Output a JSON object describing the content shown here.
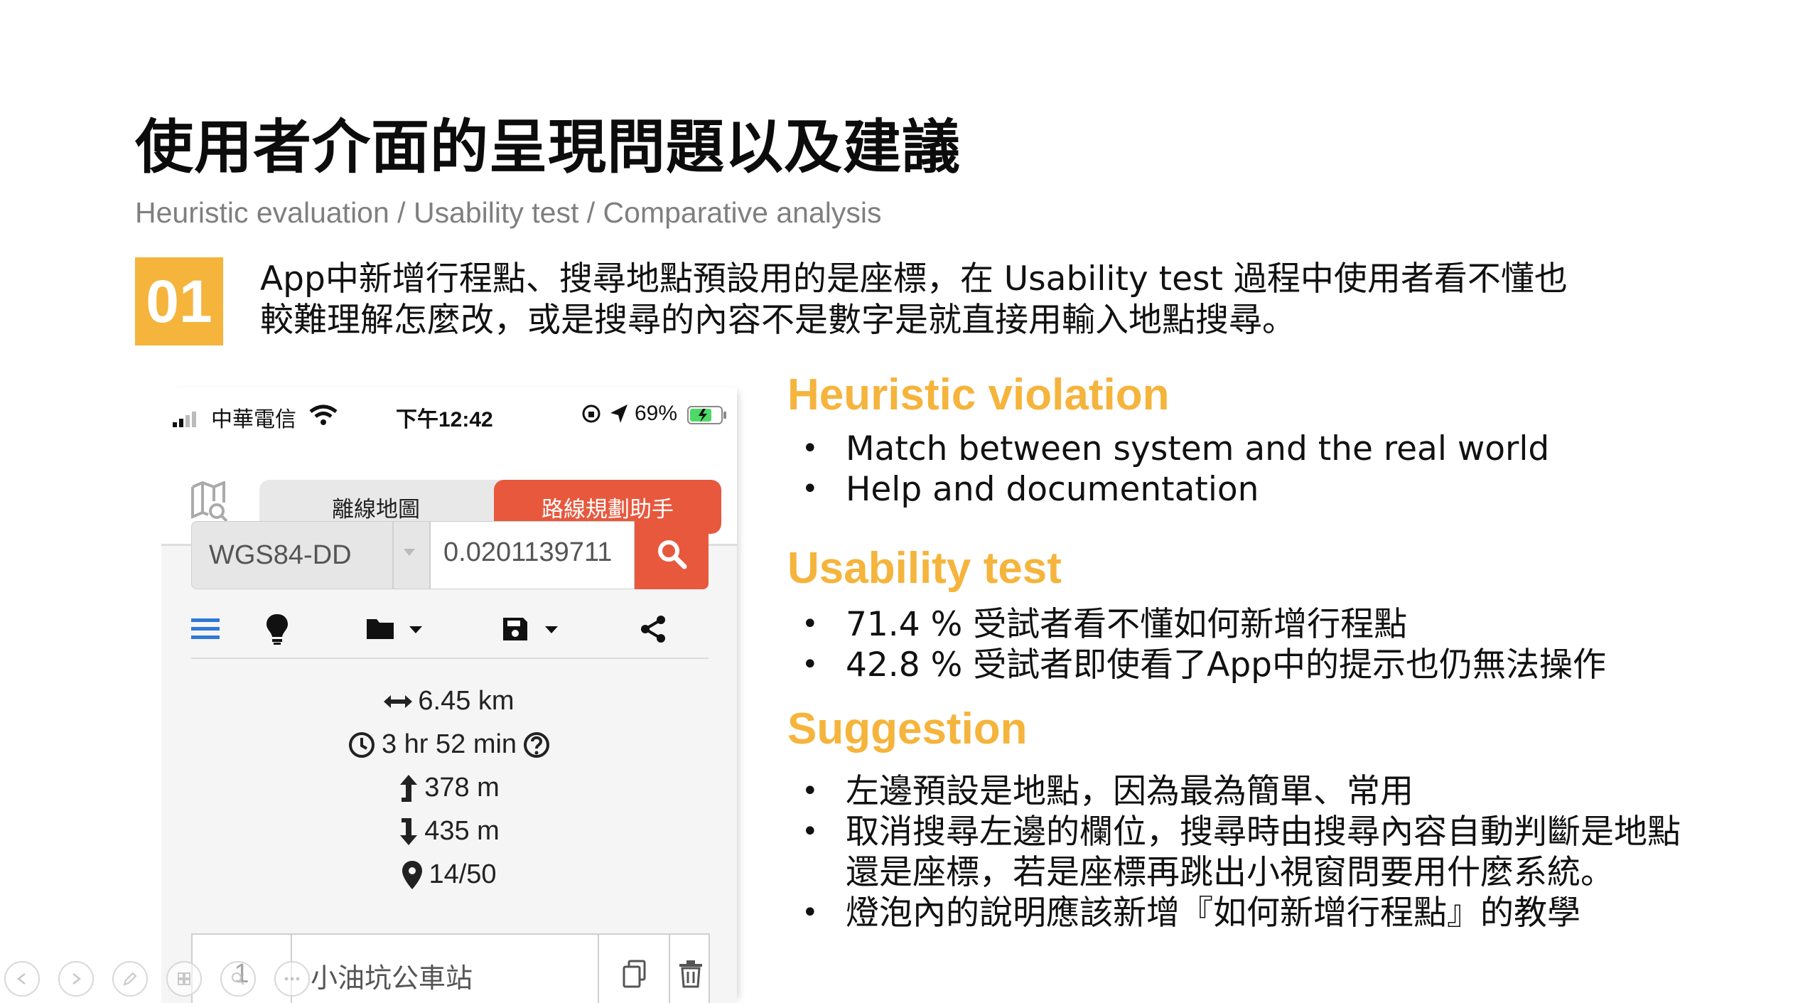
{
  "slide": {
    "title": "使用者介面的呈現問題以及建議",
    "subtitle": "Heuristic evaluation / Usability test / Comparative analysis",
    "badge": "01",
    "intro_line1": "App中新增行程點、搜尋地點預設用的是座標，在 Usability test 過程中使用者看不懂也",
    "intro_line2": "較難理解怎麼改，或是搜尋的內容不是數字是就直接用輸入地點搜尋。"
  },
  "phone": {
    "carrier": "中華電信",
    "time": "下午12:42",
    "battery": "69%",
    "tab_offline": "離線地圖",
    "tab_route": "路線規劃助手",
    "coord_system": "WGS84-DD",
    "coord_value": "0.0201139711",
    "stats": {
      "distance": "6.45 km",
      "duration": "3 hr 52 min",
      "ascent": "378 m",
      "descent": "435 m",
      "points": "14/50"
    },
    "waypoint": {
      "index": "1",
      "name": "小油坑公車站"
    }
  },
  "sections": {
    "heuristic": {
      "heading": "Heuristic violation",
      "items": [
        "Match between system and the real world",
        "Help and documentation"
      ]
    },
    "usability": {
      "heading": "Usability test",
      "items": [
        "71.4 % 受試者看不懂如何新增行程點",
        "42.8 % 受試者即使看了App中的提示也仍無法操作"
      ]
    },
    "suggestion": {
      "heading": "Suggestion",
      "items": [
        "左邊預設是地點，因為最為簡單、常用",
        "取消搜尋左邊的欄位，搜尋時由搜尋內容自動判斷是地點",
        "還是座標，若是座標再跳出小視窗問要用什麼系統。",
        "燈泡內的說明應該新增『如何新增行程點』的教學"
      ]
    }
  },
  "colors": {
    "accent": "#f5b43c",
    "app_red": "#e8583d",
    "subtitle": "#7f7f7f"
  }
}
